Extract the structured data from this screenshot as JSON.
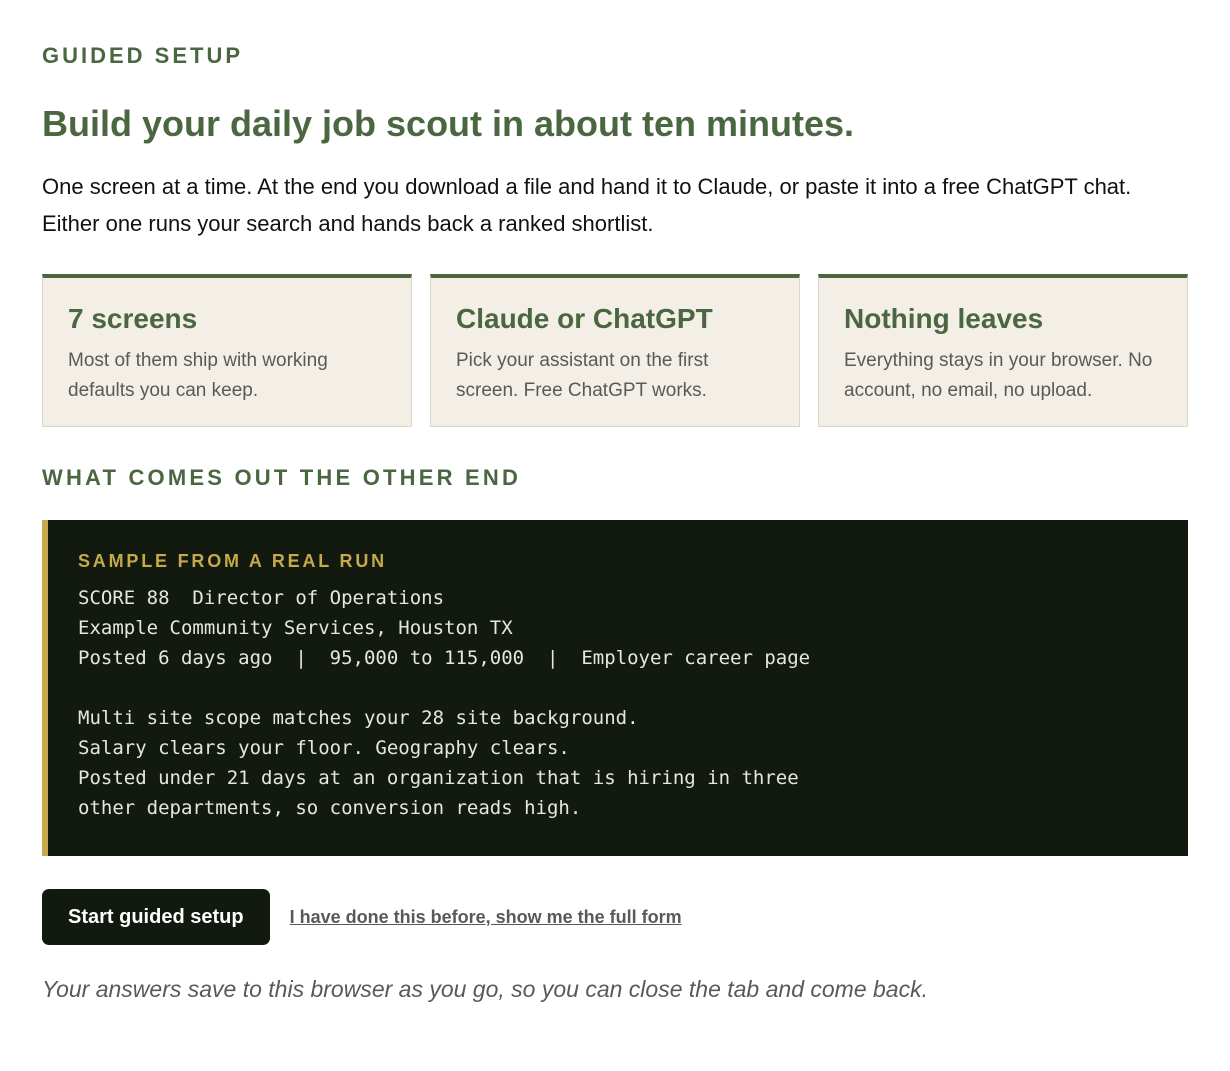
{
  "header": {
    "eyebrow": "GUIDED SETUP",
    "title": "Build your daily job scout in about ten minutes.",
    "intro": "One screen at a time. At the end you download a file and hand it to Claude, or paste it into a free ChatGPT chat. Either one runs your search and hands back a ranked shortlist."
  },
  "cards": [
    {
      "title": "7 screens",
      "body": "Most of them ship with working defaults you can keep."
    },
    {
      "title": "Claude or ChatGPT",
      "body": "Pick your assistant on the first screen. Free ChatGPT works."
    },
    {
      "title": "Nothing leaves",
      "body": "Everything stays in your browser. No account, no email, no upload."
    }
  ],
  "output_section": {
    "title": "WHAT COMES OUT THE OTHER END",
    "sample_label": "SAMPLE FROM A REAL RUN",
    "lines": [
      "SCORE 88  Director of Operations",
      "Example Community Services, Houston TX",
      "Posted 6 days ago  |  95,000 to 115,000  |  Employer career page",
      "",
      "Multi site scope matches your 28 site background.",
      "Salary clears your floor. Geography clears.",
      "Posted under 21 days at an organization that is hiring in three",
      "other departments, so conversion reads high."
    ]
  },
  "actions": {
    "primary_label": "Start guided setup",
    "secondary_label": "I have done this before, show me the full form"
  },
  "footnote": "Your answers save to this browser as you go, so you can close the tab and come back.",
  "colors": {
    "accent_green": "#4a6741",
    "card_background": "#f4efe6",
    "sample_background": "#121a10",
    "sample_accent": "#c6a94a"
  }
}
